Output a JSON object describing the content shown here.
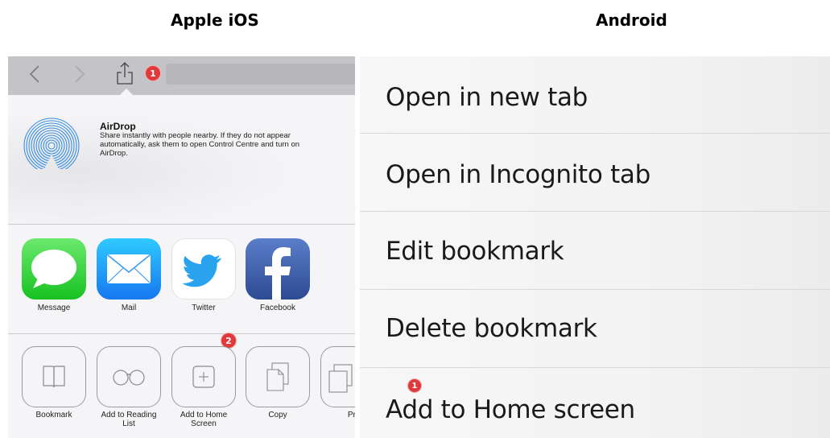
{
  "headings": {
    "ios": "Apple iOS",
    "android": "Android"
  },
  "ios": {
    "badges": {
      "share": "1",
      "add_to_home": "2"
    },
    "airdrop": {
      "title": "AirDrop",
      "description": "Share instantly with people nearby. If they do not appear automatically, ask them to open Control Centre and turn on AirDrop."
    },
    "apps": [
      {
        "label": "Message",
        "icon": "message-icon"
      },
      {
        "label": "Mail",
        "icon": "mail-icon"
      },
      {
        "label": "Twitter",
        "icon": "twitter-icon"
      },
      {
        "label": "Facebook",
        "icon": "facebook-icon"
      }
    ],
    "actions": [
      {
        "label": "Bookmark",
        "icon": "book-icon"
      },
      {
        "label": "Add to Reading List",
        "icon": "glasses-icon"
      },
      {
        "label": "Add to Home Screen",
        "icon": "plus-icon"
      },
      {
        "label": "Copy",
        "icon": "copy-icon"
      },
      {
        "label": "Pri",
        "icon": "print-icon"
      }
    ],
    "colors": {
      "badge": "#e0393b",
      "toolbar": "#c4c4c8",
      "sheet": "#f5f5f7"
    }
  },
  "android": {
    "menu": [
      {
        "label": "Open in new tab"
      },
      {
        "label": "Open in Incognito tab"
      },
      {
        "label": "Edit bookmark"
      },
      {
        "label": "Delete bookmark"
      },
      {
        "label": "Add to Home screen"
      }
    ],
    "badge": "1"
  }
}
